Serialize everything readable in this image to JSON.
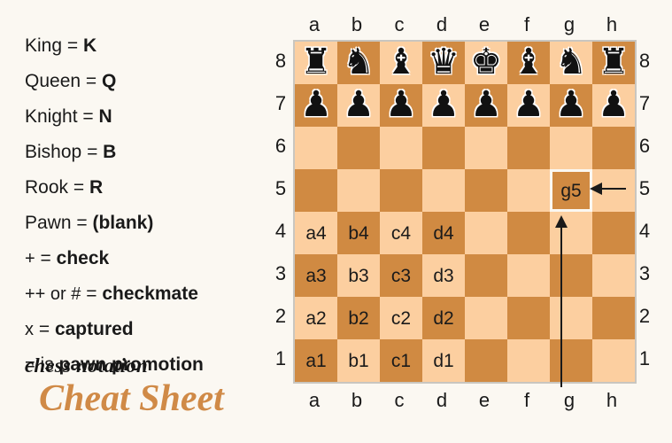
{
  "background_color": "#FBF8F2",
  "palette": {
    "light_square": "#FCCFA0",
    "dark_square": "#D08A42",
    "board_border": "#C9C6C0",
    "highlight_border": "#FBF8F2",
    "title_accent": "#D08A47",
    "text": "#1A1A1A"
  },
  "title": {
    "sub": "chess notation",
    "main": "Cheat Sheet"
  },
  "legend": {
    "rows": [
      {
        "key": "King",
        "eq": "=",
        "value": "K"
      },
      {
        "key": "Queen",
        "eq": "=",
        "value": "Q"
      },
      {
        "key": "Knight",
        "eq": "=",
        "value": "N"
      },
      {
        "key": "Bishop",
        "eq": "=",
        "value": "B"
      },
      {
        "key": "Rook",
        "eq": "=",
        "value": "R"
      },
      {
        "key": "Pawn",
        "eq": "=",
        "value": "(blank)"
      },
      {
        "key": "+",
        "eq": "=",
        "value": "check"
      },
      {
        "key": "++ or #",
        "eq": "=",
        "value": "checkmate"
      },
      {
        "key": "x",
        "eq": "=",
        "value": "captured"
      },
      {
        "key": "=",
        "eq": "is",
        "value": "pawn promotion"
      }
    ]
  },
  "board": {
    "files": [
      "a",
      "b",
      "c",
      "d",
      "e",
      "f",
      "g",
      "h"
    ],
    "ranks": [
      "8",
      "7",
      "6",
      "5",
      "4",
      "3",
      "2",
      "1"
    ],
    "highlight_square": "g5",
    "pieces": {
      "a8": "rook",
      "b8": "knight",
      "c8": "bishop",
      "d8": "queen",
      "e8": "king",
      "f8": "bishop",
      "g8": "knight",
      "h8": "rook",
      "a7": "pawn",
      "b7": "pawn",
      "c7": "pawn",
      "d7": "pawn",
      "e7": "pawn",
      "f7": "pawn",
      "g7": "pawn",
      "h7": "pawn"
    },
    "piece_glyphs": {
      "king": "♚",
      "queen": "♛",
      "rook": "♜",
      "bishop": "♝",
      "knight": "♞",
      "pawn": "♟"
    },
    "coordinate_labels": {
      "a4": "a4",
      "b4": "b4",
      "c4": "c4",
      "d4": "d4",
      "a3": "a3",
      "b3": "b3",
      "c3": "c3",
      "d3": "d3",
      "a2": "a2",
      "b2": "b2",
      "c2": "c2",
      "d2": "d2",
      "a1": "a1",
      "b1": "b1",
      "c1": "c1",
      "d1": "d1",
      "g5": "g5"
    }
  },
  "annotations": {
    "rank_arrow": {
      "from": "rank-label-5",
      "to": "g5",
      "direction": "left"
    },
    "file_arrow": {
      "from": "file-label-g",
      "to": "g5",
      "direction": "up"
    }
  }
}
